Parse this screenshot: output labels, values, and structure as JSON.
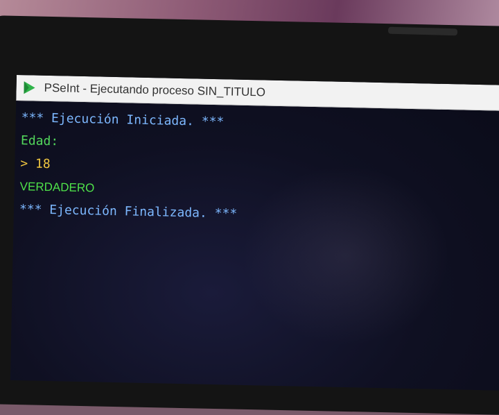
{
  "window": {
    "title": "PSeInt - Ejecutando proceso SIN_TITULO",
    "icon": "pseint-app-icon"
  },
  "console": {
    "lines": [
      {
        "text": "*** Ejecución Iniciada. ***",
        "color": "#7db8ff"
      },
      {
        "text": "Edad:",
        "color": "#53d85c"
      },
      {
        "text": "> 18",
        "color": "#f0c640"
      },
      {
        "text": "VERDADERO",
        "color": "#4fe24a"
      },
      {
        "text": "*** Ejecución Finalizada. ***",
        "color": "#7db8ff"
      }
    ]
  }
}
